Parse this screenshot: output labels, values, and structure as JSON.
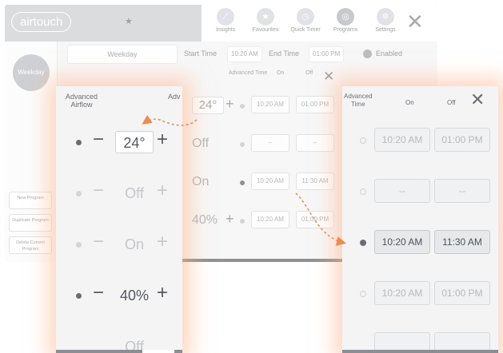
{
  "app": {
    "logo": "airtouch",
    "nav": [
      {
        "label": "Insights",
        "icon": "chart-icon"
      },
      {
        "label": "Favourites",
        "icon": "star-icon"
      },
      {
        "label": "Quick Timer",
        "icon": "clock-icon"
      },
      {
        "label": "Programs",
        "icon": "programs-icon"
      },
      {
        "label": "Settings",
        "icon": "gear-icon"
      }
    ],
    "weekday_circle": "Weekday",
    "program_name": "Weekday",
    "start_time_label": "Start Time",
    "start_time": "10:20 AM",
    "end_time_label": "End Time",
    "end_time": "01:00 PM",
    "enabled_label": "Enabled",
    "side_buttons": [
      "New Program",
      "Duplicate Program",
      "Delete Current Program"
    ]
  },
  "middle": {
    "header": {
      "advanced_time": "Advanced Time",
      "on": "On",
      "off": "Off"
    },
    "rows": [
      {
        "value": "24°",
        "start": "10:20 AM",
        "end": "01:00 PM",
        "boxed": true
      },
      {
        "value": "Off",
        "start": "--",
        "end": "--"
      },
      {
        "value": "On",
        "start": "10:20 AM",
        "end": "11:30 AM",
        "active": true
      },
      {
        "value": "40%",
        "start": "10:20 AM",
        "end": "01:00 PM"
      }
    ]
  },
  "airflow_panel": {
    "title_line1": "Advanced",
    "title_line2": "Airflow",
    "title_adv_partial": "Adv",
    "rows": [
      {
        "value": "24°",
        "active": true,
        "boxed": true
      },
      {
        "value": "Off",
        "active": false
      },
      {
        "value": "On",
        "active": false
      },
      {
        "value": "40%",
        "active": true
      },
      {
        "value": "Off",
        "active": false
      }
    ]
  },
  "time_panel": {
    "title_line1": "Advanced",
    "title_line2": "Time",
    "on_label": "On",
    "off_label": "Off",
    "rows": [
      {
        "start": "10:20 AM",
        "end": "01:00 PM",
        "active": false
      },
      {
        "start": "--",
        "end": "--",
        "active": false
      },
      {
        "start": "10:20 AM",
        "end": "11:30 AM",
        "active": true
      },
      {
        "start": "10:20 AM",
        "end": "01:00 PM",
        "active": false
      },
      {
        "start": "",
        "end": "",
        "active": false
      }
    ]
  },
  "colors": {
    "accent_arrow": "#ee8a4a",
    "glow": "#ffb48c"
  }
}
